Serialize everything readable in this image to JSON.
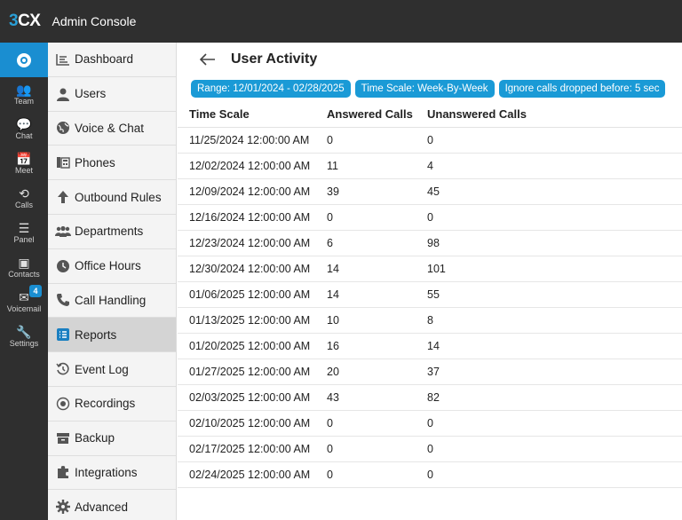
{
  "app": {
    "logo_three": "3",
    "logo_cx": "CX",
    "title": "Admin Console"
  },
  "rail": {
    "items": [
      {
        "label": "Team",
        "icon": "team-icon",
        "glyph": "👥"
      },
      {
        "label": "Chat",
        "icon": "chat-icon",
        "glyph": "💬"
      },
      {
        "label": "Meet",
        "icon": "meet-icon",
        "glyph": "📅"
      },
      {
        "label": "Calls",
        "icon": "calls-history-icon",
        "glyph": "⟲"
      },
      {
        "label": "Panel",
        "icon": "panel-icon",
        "glyph": "☰"
      },
      {
        "label": "Contacts",
        "icon": "contacts-icon",
        "glyph": "▣"
      },
      {
        "label": "Voicemail",
        "icon": "voicemail-icon",
        "glyph": "✉",
        "badge": "4"
      },
      {
        "label": "Settings",
        "icon": "wrench-icon",
        "glyph": "🔧"
      }
    ]
  },
  "sidenav": {
    "items": [
      {
        "label": "Dashboard",
        "icon": "dashboard-icon"
      },
      {
        "label": "Users",
        "icon": "user-icon"
      },
      {
        "label": "Voice & Chat",
        "icon": "globe-icon"
      },
      {
        "label": "Phones",
        "icon": "phone-desk-icon"
      },
      {
        "label": "Outbound Rules",
        "icon": "arrow-up-icon"
      },
      {
        "label": "Departments",
        "icon": "departments-icon"
      },
      {
        "label": "Office Hours",
        "icon": "clock-icon"
      },
      {
        "label": "Call Handling",
        "icon": "phone-handset-icon"
      },
      {
        "label": "Reports",
        "icon": "reports-icon",
        "active": true
      },
      {
        "label": "Event Log",
        "icon": "history-icon"
      },
      {
        "label": "Recordings",
        "icon": "record-icon"
      },
      {
        "label": "Backup",
        "icon": "archive-icon"
      },
      {
        "label": "Integrations",
        "icon": "puzzle-icon"
      },
      {
        "label": "Advanced",
        "icon": "gear-icon"
      }
    ]
  },
  "page": {
    "title": "User Activity",
    "filters": {
      "range": "Range: 12/01/2024 - 02/28/2025",
      "time_scale": "Time Scale: Week-By-Week",
      "ignore": "Ignore calls dropped before: 5 sec"
    }
  },
  "table": {
    "headers": [
      "Time Scale",
      "Answered Calls",
      "Unanswered Calls"
    ],
    "rows": [
      [
        "11/25/2024 12:00:00 AM",
        "0",
        "0"
      ],
      [
        "12/02/2024 12:00:00 AM",
        "11",
        "4"
      ],
      [
        "12/09/2024 12:00:00 AM",
        "39",
        "45"
      ],
      [
        "12/16/2024 12:00:00 AM",
        "0",
        "0"
      ],
      [
        "12/23/2024 12:00:00 AM",
        "6",
        "98"
      ],
      [
        "12/30/2024 12:00:00 AM",
        "14",
        "101"
      ],
      [
        "01/06/2025 12:00:00 AM",
        "14",
        "55"
      ],
      [
        "01/13/2025 12:00:00 AM",
        "10",
        "8"
      ],
      [
        "01/20/2025 12:00:00 AM",
        "16",
        "14"
      ],
      [
        "01/27/2025 12:00:00 AM",
        "20",
        "37"
      ],
      [
        "02/03/2025 12:00:00 AM",
        "43",
        "82"
      ],
      [
        "02/10/2025 12:00:00 AM",
        "0",
        "0"
      ],
      [
        "02/17/2025 12:00:00 AM",
        "0",
        "0"
      ],
      [
        "02/24/2025 12:00:00 AM",
        "0",
        "0"
      ]
    ]
  },
  "colors": {
    "accent": "#1a9ad6",
    "topbar": "#2f2f2f",
    "active_nav": "#d4d4d4"
  }
}
